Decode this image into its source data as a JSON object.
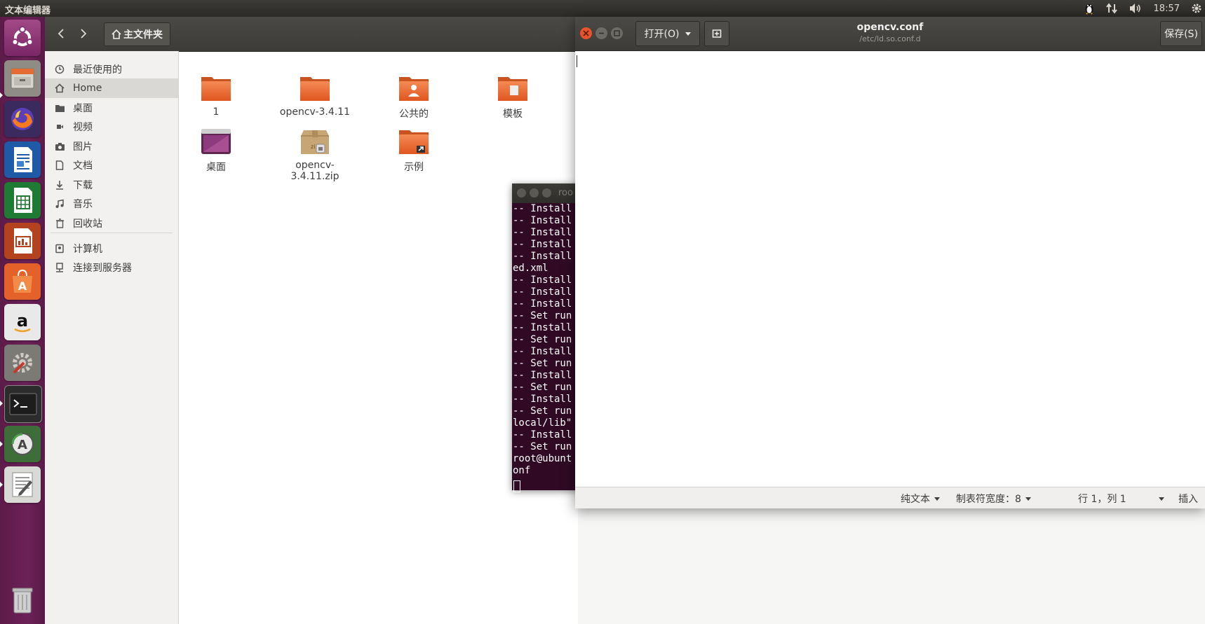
{
  "top_panel": {
    "app_title": "文本编辑器",
    "clock": "18:57"
  },
  "launcher": {
    "items": [
      {
        "name": "Ubuntu Dash",
        "icon": "ubuntu-logo-icon"
      },
      {
        "name": "Files",
        "icon": "files-icon"
      },
      {
        "name": "Firefox",
        "icon": "firefox-icon"
      },
      {
        "name": "LibreOffice Writer",
        "icon": "writer-icon"
      },
      {
        "name": "LibreOffice Calc",
        "icon": "calc-icon"
      },
      {
        "name": "LibreOffice Impress",
        "icon": "impress-icon"
      },
      {
        "name": "Ubuntu Software",
        "icon": "software-center-icon"
      },
      {
        "name": "Amazon",
        "icon": "amazon-icon"
      },
      {
        "name": "System Settings",
        "icon": "settings-icon"
      },
      {
        "name": "Terminal",
        "icon": "terminal-icon"
      },
      {
        "name": "Software Updater",
        "icon": "updater-icon"
      },
      {
        "name": "Text Editor",
        "icon": "text-editor-icon"
      },
      {
        "name": "Trash",
        "icon": "trash-icon"
      }
    ]
  },
  "file_manager": {
    "path_label": "主文件夹",
    "sidebar": [
      {
        "label": "最近使用的",
        "icon": "clock-icon"
      },
      {
        "label": "Home",
        "icon": "home-icon"
      },
      {
        "label": "桌面",
        "icon": "folder-icon"
      },
      {
        "label": "视频",
        "icon": "video-icon"
      },
      {
        "label": "图片",
        "icon": "camera-icon"
      },
      {
        "label": "文档",
        "icon": "document-icon"
      },
      {
        "label": "下载",
        "icon": "download-icon"
      },
      {
        "label": "音乐",
        "icon": "music-icon"
      },
      {
        "label": "回收站",
        "icon": "trash-icon"
      },
      {
        "label": "计算机",
        "icon": "computer-icon"
      },
      {
        "label": "连接到服务器",
        "icon": "server-icon"
      }
    ],
    "files": [
      {
        "label": "1",
        "icon": "folder-icon"
      },
      {
        "label": "opencv-3.4.11",
        "icon": "folder-icon"
      },
      {
        "label": "公共的",
        "icon": "public-folder-icon"
      },
      {
        "label": "模板",
        "icon": "templates-folder-icon"
      },
      {
        "label": "桌面",
        "icon": "desktop-folder-icon"
      },
      {
        "label": "opencv-3.4.11.zip",
        "icon": "zip-archive-icon"
      },
      {
        "label": "示例",
        "icon": "examples-folder-icon"
      }
    ]
  },
  "terminal": {
    "title": "roo",
    "lines": [
      "-- Install",
      "-- Install",
      "-- Install",
      "-- Install",
      "-- Install",
      "ed.xml",
      "-- Install",
      "-- Install",
      "-- Install",
      "-- Set run",
      "-- Install",
      "-- Set run",
      "-- Install",
      "-- Set run",
      "-- Install",
      "-- Set run",
      "-- Install",
      "-- Set run",
      "local/lib\"",
      "-- Install",
      "-- Set run",
      "root@ubunt",
      "onf"
    ]
  },
  "gedit": {
    "open_label": "打开(O)",
    "doc_title": "opencv.conf",
    "doc_path": "/etc/ld.so.conf.d",
    "save_label": "保存(S)",
    "status": {
      "syntax": "纯文本",
      "tab_width": "制表符宽度：8",
      "position": "行 1，列 1",
      "mode": "插入"
    }
  }
}
